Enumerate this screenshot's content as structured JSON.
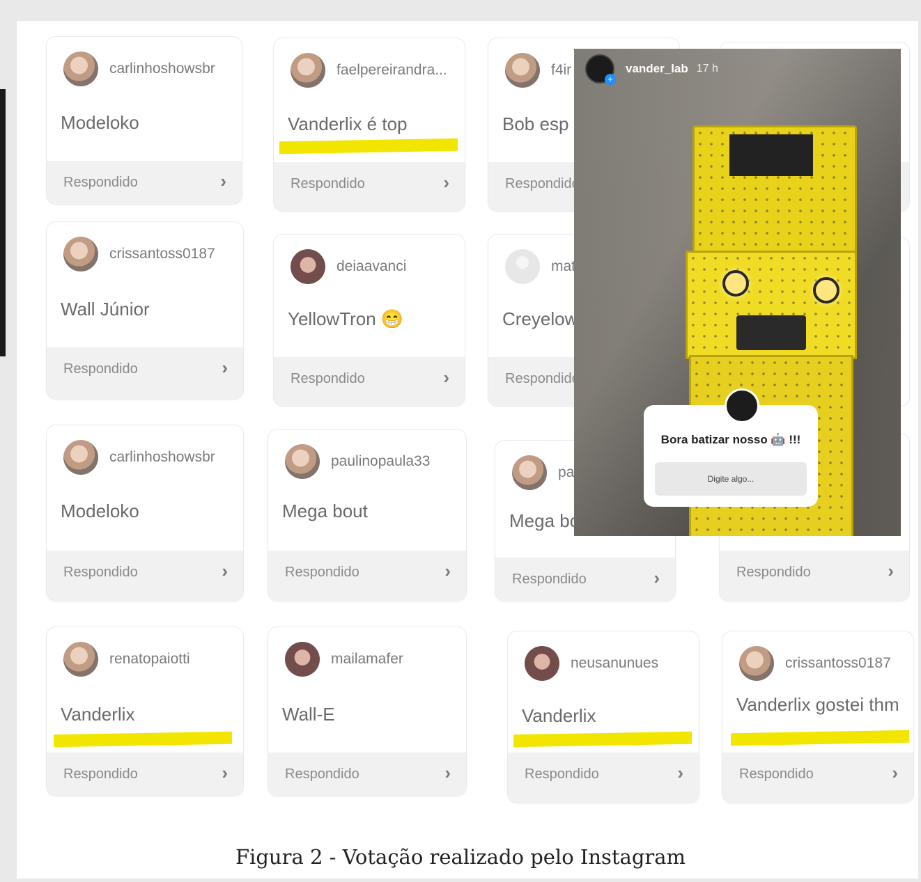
{
  "status_label": "Respondido",
  "cards": [
    {
      "user": "carlinhoshowsbr",
      "answer": "Modeloko"
    },
    {
      "user": "faelpereirandra...",
      "answer": "Vanderlix é top"
    },
    {
      "user": "f4ir",
      "answer": "Bob esp"
    },
    {
      "user": "crissantoss0187",
      "answer": "Wall Júnior"
    },
    {
      "user": "deiaavanci",
      "answer": "YellowTron 😁"
    },
    {
      "user": "mat",
      "answer": "Creyelow"
    },
    {
      "user": "carlinhoshowsbr",
      "answer": "Modeloko"
    },
    {
      "user": "paulinopaula33",
      "answer": "Mega bout"
    },
    {
      "user": "pau",
      "answer": "Mega bo"
    },
    {
      "user": "renatopaiotti",
      "answer": "Vanderlix"
    },
    {
      "user": "mailamafer",
      "answer": "Wall-E"
    },
    {
      "user": "neusanunues",
      "answer": "Vanderlix"
    },
    {
      "user": "crissantoss0187",
      "answer": "Vanderlix gostei thm"
    }
  ],
  "story": {
    "username": "vander_lab",
    "time": "17 h",
    "question": "Bora batizar nosso 🤖 !!!",
    "input_placeholder": "Digite algo..."
  },
  "caption": "Figura 2 - Votação realizado pelo Instagram",
  "colors": {
    "highlight": "#f2e600",
    "robot_yellow": "#e8d21a"
  }
}
